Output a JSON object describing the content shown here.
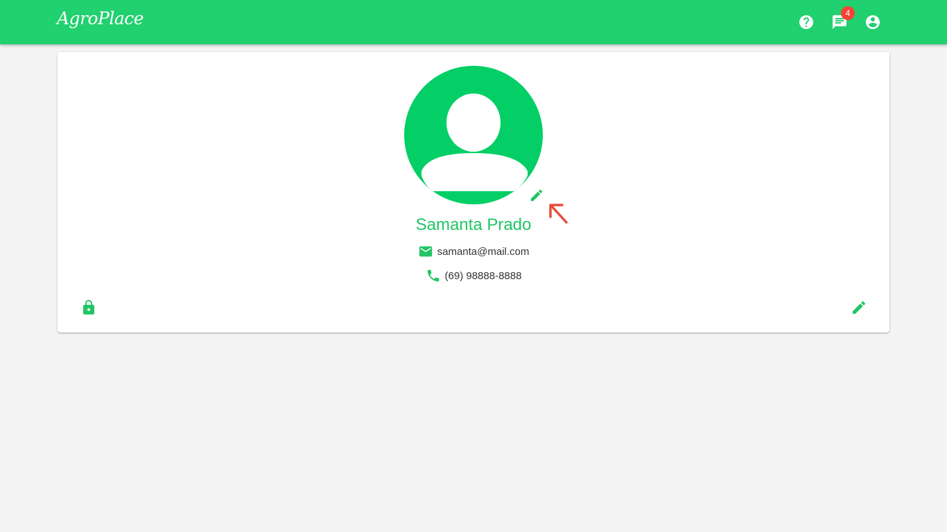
{
  "header": {
    "logo_text": "AgroPlace",
    "icons": [
      "help-icon",
      "chat-icon",
      "account-icon"
    ],
    "notification_count": "4"
  },
  "profile": {
    "name": "Samanta Prado",
    "email": "samanta@mail.com",
    "phone": "(69) 98888-8888"
  },
  "colors": {
    "primary": "#21d06f",
    "accent_text": "#21c564",
    "badge": "#f44336",
    "annotation_arrow": "#e74c3c",
    "background": "#f4f4f4"
  }
}
